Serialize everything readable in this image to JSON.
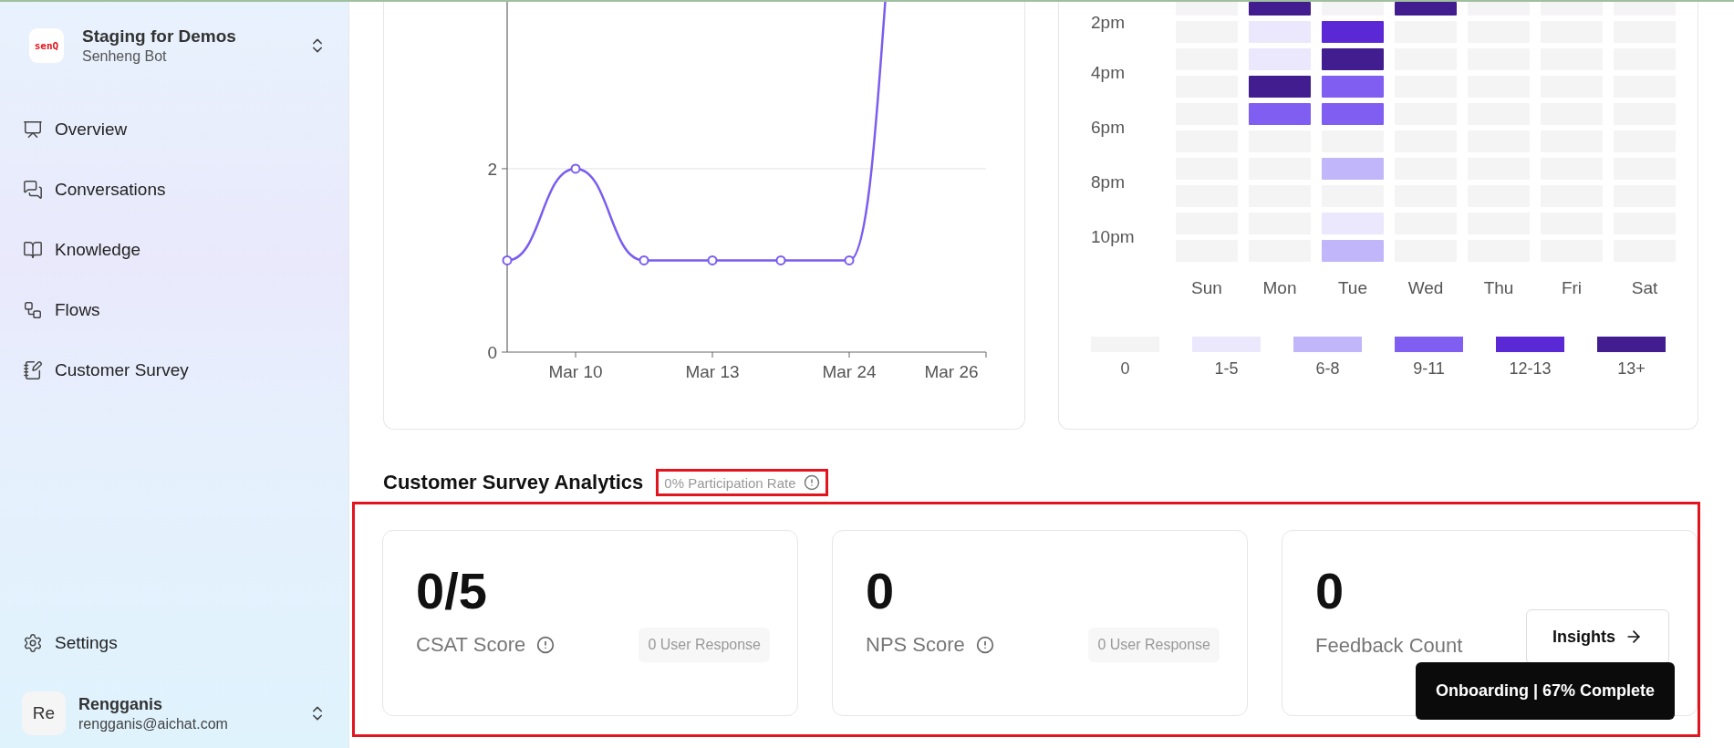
{
  "sidebar": {
    "workspace": {
      "logo": "senQ",
      "title": "Staging for Demos",
      "subtitle": "Senheng Bot"
    },
    "items": [
      {
        "kind": "overview",
        "label": "Overview"
      },
      {
        "kind": "conversations",
        "label": "Conversations"
      },
      {
        "kind": "knowledge",
        "label": "Knowledge"
      },
      {
        "kind": "flows",
        "label": "Flows"
      },
      {
        "kind": "survey",
        "label": "Customer Survey"
      }
    ],
    "settings": {
      "label": "Settings"
    },
    "user": {
      "initials": "Re",
      "name": "Rengganis",
      "email": "rengganis@aichat.com"
    }
  },
  "line_chart": {
    "line_leaves_top": true,
    "chart_data": {
      "type": "line",
      "categories": [
        null,
        "Mar 10",
        null,
        "Mar 13",
        null,
        "Mar 24",
        null,
        "Mar 26"
      ],
      "yticks": [
        0,
        2
      ],
      "ylim": [
        0,
        3.8
      ],
      "series": [
        {
          "color": "#7b5cf0",
          "marker": "circle",
          "values": [
            1,
            2,
            1,
            1,
            1,
            1,
            null,
            null
          ]
        }
      ]
    }
  },
  "heatmap": {
    "hours": [
      "2pm",
      "4pm",
      "6pm",
      "8pm",
      "10pm"
    ],
    "days": [
      "Sun",
      "Mon",
      "Tue",
      "Wed",
      "Thu",
      "Fri",
      "Sat"
    ],
    "rows": [
      {
        "cells": [
          {
            "color": "#f4f4f4"
          },
          {
            "color": "#421d8f"
          },
          {
            "color": "#f4f4f4"
          },
          {
            "color": "#421d8f"
          },
          {
            "color": "#f4f4f4"
          },
          {
            "color": "#f4f4f4"
          },
          {
            "color": "#f4f4f4"
          }
        ]
      },
      {
        "cells": [
          {
            "color": "#f4f4f4"
          },
          {
            "color": "#ebe7fd"
          },
          {
            "color": "#5b28d6"
          },
          {
            "color": "#f4f4f4"
          },
          {
            "color": "#f4f4f4"
          },
          {
            "color": "#f4f4f4"
          },
          {
            "color": "#f4f4f4"
          }
        ]
      },
      {
        "cells": [
          {
            "color": "#f4f4f4"
          },
          {
            "color": "#ebe7fd"
          },
          {
            "color": "#421d8f"
          },
          {
            "color": "#f4f4f4"
          },
          {
            "color": "#f4f4f4"
          },
          {
            "color": "#f4f4f4"
          },
          {
            "color": "#f4f4f4"
          }
        ]
      },
      {
        "cells": [
          {
            "color": "#f4f4f4"
          },
          {
            "color": "#421d8f"
          },
          {
            "color": "#7f5ef1"
          },
          {
            "color": "#f4f4f4"
          },
          {
            "color": "#f4f4f4"
          },
          {
            "color": "#f4f4f4"
          },
          {
            "color": "#f4f4f4"
          }
        ]
      },
      {
        "cells": [
          {
            "color": "#f4f4f4"
          },
          {
            "color": "#7f5ef1"
          },
          {
            "color": "#7f5ef1"
          },
          {
            "color": "#f4f4f4"
          },
          {
            "color": "#f4f4f4"
          },
          {
            "color": "#f4f4f4"
          },
          {
            "color": "#f4f4f4"
          }
        ]
      },
      {
        "cells": [
          {
            "color": "#f4f4f4"
          },
          {
            "color": "#f4f4f4"
          },
          {
            "color": "#f4f4f4"
          },
          {
            "color": "#f4f4f4"
          },
          {
            "color": "#f4f4f4"
          },
          {
            "color": "#f4f4f4"
          },
          {
            "color": "#f4f4f4"
          }
        ]
      },
      {
        "cells": [
          {
            "color": "#f4f4f4"
          },
          {
            "color": "#f4f4f4"
          },
          {
            "color": "#c1b6f9"
          },
          {
            "color": "#f4f4f4"
          },
          {
            "color": "#f4f4f4"
          },
          {
            "color": "#f4f4f4"
          },
          {
            "color": "#f4f4f4"
          }
        ]
      },
      {
        "cells": [
          {
            "color": "#f4f4f4"
          },
          {
            "color": "#f4f4f4"
          },
          {
            "color": "#f4f4f4"
          },
          {
            "color": "#f4f4f4"
          },
          {
            "color": "#f4f4f4"
          },
          {
            "color": "#f4f4f4"
          },
          {
            "color": "#f4f4f4"
          }
        ]
      },
      {
        "cells": [
          {
            "color": "#f4f4f4"
          },
          {
            "color": "#f4f4f4"
          },
          {
            "color": "#ebe7fd"
          },
          {
            "color": "#f4f4f4"
          },
          {
            "color": "#f4f4f4"
          },
          {
            "color": "#f4f4f4"
          },
          {
            "color": "#f4f4f4"
          }
        ]
      },
      {
        "cells": [
          {
            "color": "#f4f4f4"
          },
          {
            "color": "#f4f4f4"
          },
          {
            "color": "#c1b6f9"
          },
          {
            "color": "#f4f4f4"
          },
          {
            "color": "#f4f4f4"
          },
          {
            "color": "#f4f4f4"
          },
          {
            "color": "#f4f4f4"
          }
        ]
      }
    ],
    "legend": [
      {
        "label": "0",
        "color": "#f4f4f4"
      },
      {
        "label": "1-5",
        "color": "#ebe7fd"
      },
      {
        "label": "6-8",
        "color": "#c1b6f9"
      },
      {
        "label": "9-11",
        "color": "#7f5ef1"
      },
      {
        "label": "12-13",
        "color": "#5b28d6"
      },
      {
        "label": "13+",
        "color": "#421d8f"
      }
    ]
  },
  "survey": {
    "title": "Customer Survey Analytics",
    "participation": "0% Participation Rate",
    "cards": [
      {
        "kind": "score",
        "value": "0/5",
        "label": "CSAT Score",
        "responses": "0 User Response"
      },
      {
        "kind": "score",
        "value": "0",
        "label": "NPS Score",
        "responses": "0 User Response"
      },
      {
        "kind": "feedback",
        "value": "0",
        "label": "Feedback Count",
        "button": "Insights"
      }
    ]
  },
  "toast": {
    "text": "Onboarding | 67% Complete"
  }
}
